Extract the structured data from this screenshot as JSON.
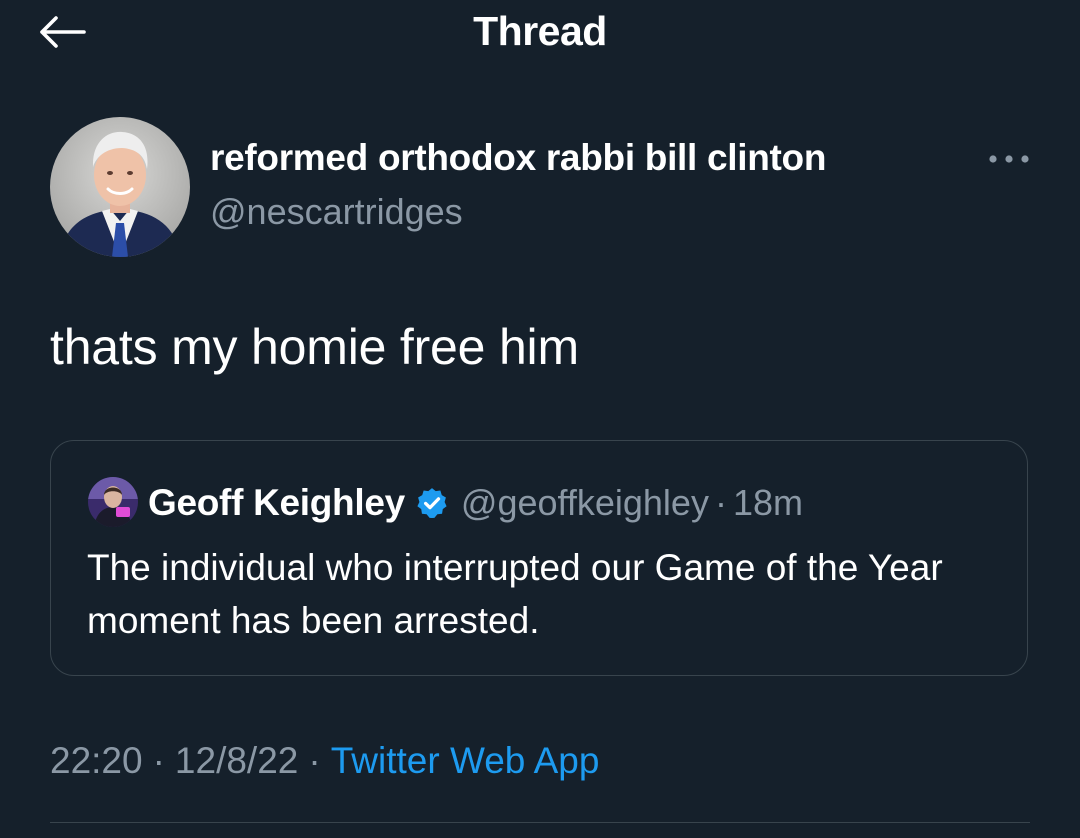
{
  "header": {
    "title": "Thread",
    "back_icon": "arrow-left-icon"
  },
  "tweet": {
    "author": {
      "display_name": "reformed orthodox rabbi bill clinton",
      "handle": "@nescartridges"
    },
    "more_icon": "more-horizontal-icon",
    "text": "thats my homie free him",
    "quoted": {
      "display_name": "Geoff Keighley",
      "verified": true,
      "handle": "@geoffkeighley",
      "separator": "·",
      "time": "18m",
      "text": "The individual who interrupted our Game of the Year moment has been arrested."
    },
    "meta": {
      "time": "22:20",
      "separator": "·",
      "date": "12/8/22",
      "source": "Twitter Web App"
    }
  },
  "colors": {
    "background": "#15202b",
    "secondary_text": "#8b98a5",
    "accent": "#1d9bf0",
    "border": "#38444d"
  }
}
